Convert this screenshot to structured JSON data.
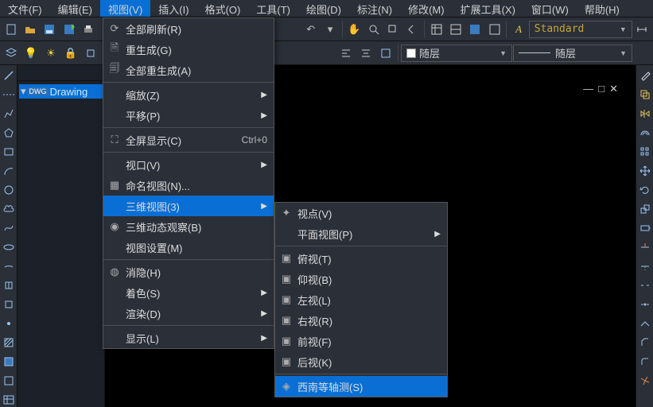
{
  "menubar": {
    "file": "文件(F)",
    "edit": "编辑(E)",
    "view": "视图(V)",
    "insert": "插入(I)",
    "format": "格式(O)",
    "tools": "工具(T)",
    "draw": "绘图(D)",
    "dimension": "标注(N)",
    "modify": "修改(M)",
    "ext": "扩展工具(X)",
    "window": "窗口(W)",
    "help": "帮助(H)"
  },
  "toolbar": {
    "style_dropdown": "Standard",
    "layer_dropdown": "随层",
    "layer_dropdown2": "随层"
  },
  "file_tree": {
    "item0": "Drawing"
  },
  "view_menu": {
    "refresh_all": "全部刷新(R)",
    "regen": "重生成(G)",
    "regen_all": "全部重生成(A)",
    "zoom": "缩放(Z)",
    "pan": "平移(P)",
    "fullscreen": "全屏显示(C)",
    "fullscreen_accel": "Ctrl+0",
    "viewport": "视口(V)",
    "named_views": "命名视图(N)...",
    "views_3d": "三维视图(3)",
    "orbit_3d": "三维动态观察(B)",
    "view_settings": "视图设置(M)",
    "hide": "消隐(H)",
    "shade": "着色(S)",
    "render": "渲染(D)",
    "display": "显示(L)"
  },
  "sub3d": {
    "viewpoint": "视点(V)",
    "plan": "平面视图(P)",
    "top": "俯视(T)",
    "bottom": "仰视(B)",
    "left": "左视(L)",
    "right": "右视(R)",
    "front": "前视(F)",
    "back": "后视(K)",
    "sw_iso": "西南等轴测(S)"
  }
}
